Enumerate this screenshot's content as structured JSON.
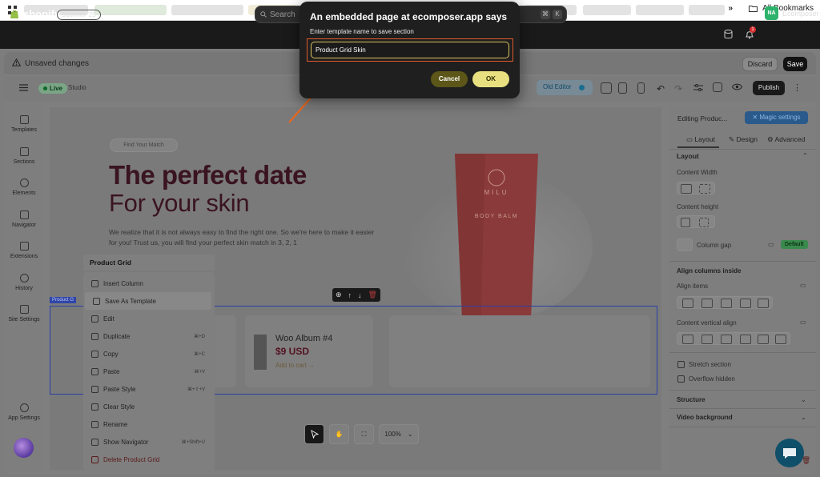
{
  "browser": {
    "bookmarks_label": "All Bookmarks",
    "overflow": "»"
  },
  "shopify": {
    "logo": "shopify",
    "edition": "Summer '25",
    "search_placeholder": "Search",
    "shortcut_keys": [
      "⌘",
      "K"
    ],
    "notification_count": "1",
    "store_initials": "NA",
    "store_name": "Ecomposer"
  },
  "unsaved_bar": {
    "title": "Unsaved changes",
    "discard": "Discard",
    "save": "Save"
  },
  "toolbar": {
    "live": "Live",
    "studio": "Studio",
    "old_editor": "Old Editor",
    "publish": "Publish"
  },
  "rail": {
    "items": [
      {
        "label": "Templates"
      },
      {
        "label": "Sections"
      },
      {
        "label": "Elements"
      },
      {
        "label": "Navigator"
      },
      {
        "label": "Extensions"
      },
      {
        "label": "History"
      },
      {
        "label": "Site Settings"
      }
    ],
    "app_settings": "App Settings"
  },
  "canvas": {
    "badge": "Find Your Match",
    "heading1": "The perfect date",
    "heading2": "For your skin",
    "paragraph": "We realize that it is not always easy to find the right one. So we're here to make it easier for you! Trust us, you will find your perfect skin match in 3, 2, 1",
    "grid_tag": "Product G",
    "tube_brand": "MILU",
    "tube_product": "BODY BALM",
    "product": {
      "name": "Woo Album #4",
      "price": "$9 USD",
      "add_to_cart": "Add to cart →"
    },
    "zoom": "100%"
  },
  "context_menu": {
    "title": "Product Grid",
    "items": [
      {
        "label": "Insert Column",
        "shortcut": ""
      },
      {
        "label": "Save As Template",
        "shortcut": ""
      },
      {
        "label": "Edit",
        "shortcut": ""
      },
      {
        "label": "Duplicate",
        "shortcut": "⌘+D"
      },
      {
        "label": "Copy",
        "shortcut": "⌘+C"
      },
      {
        "label": "Paste",
        "shortcut": "⌘+V"
      },
      {
        "label": "Paste Style",
        "shortcut": "⌘+⇧+V"
      },
      {
        "label": "Clear Style",
        "shortcut": ""
      },
      {
        "label": "Rename",
        "shortcut": ""
      },
      {
        "label": "Show Navigator",
        "shortcut": "⌘+Shift+U"
      },
      {
        "label": "Delete Product Grid",
        "shortcut": ""
      }
    ]
  },
  "right_panel": {
    "title": "Editing Produc...",
    "magic": "Magic settings",
    "tabs": [
      "Layout",
      "Design",
      "Advanced"
    ],
    "section_layout": "Layout",
    "content_width": "Content Width",
    "content_height": "Content height",
    "column_gap": "Column gap",
    "column_gap_value": "Default",
    "align_columns": "Align columns inside",
    "align_items": "Align items",
    "content_valign": "Content vertical align",
    "stretch_section": "Stretch section",
    "overflow_hidden": "Overflow hidden",
    "structure": "Structure",
    "video_background": "Video background"
  },
  "dialog": {
    "title": "An embedded page at ecomposer.app says",
    "label": "Enter template name to save section",
    "value": "Product Grid Skin",
    "cancel": "Cancel",
    "ok": "OK"
  },
  "colors": {
    "accent_orange": "#e05a2a",
    "ok_yellow": "#e8e080",
    "heading_maroon": "#3a1420"
  }
}
